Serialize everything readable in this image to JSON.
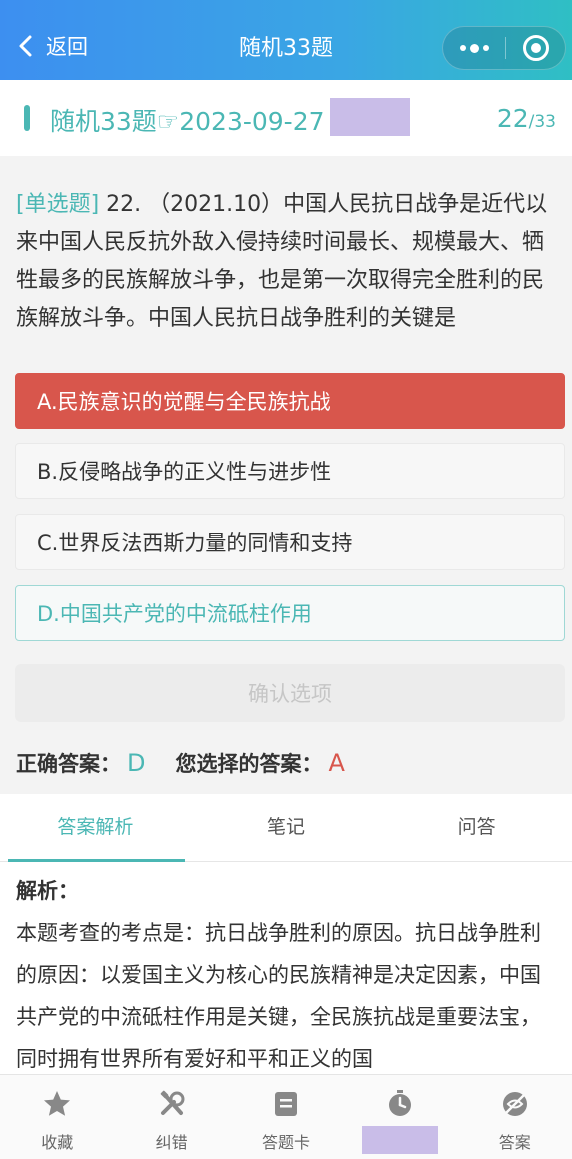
{
  "topbar": {
    "back_label": "返回",
    "title": "随机33题"
  },
  "quiz_header": {
    "title": "随机33题☞2023-09-27",
    "current": "22",
    "total": "/33"
  },
  "question": {
    "type_label": "[单选题]",
    "text": " 22. （2021.10）中国人民抗日战争是近代以来中国人民反抗外敌入侵持续时间最长、规模最大、牺牲最多的民族解放斗争，也是第一次取得完全胜利的民族解放斗争。中国人民抗日战争胜利的关键是"
  },
  "options": [
    {
      "label": "A.民族意识的觉醒与全民族抗战",
      "state": "wrong"
    },
    {
      "label": "B.反侵略战争的正义性与进步性",
      "state": "normal"
    },
    {
      "label": "C.世界反法西斯力量的同情和支持",
      "state": "normal"
    },
    {
      "label": "D.中国共产党的中流砥柱作用",
      "state": "correct"
    }
  ],
  "confirm_label": "确认选项",
  "result": {
    "correct_label": "正确答案：",
    "correct_value": "D",
    "chosen_label": "您选择的答案：",
    "chosen_value": "A"
  },
  "tabs": [
    {
      "label": "答案解析",
      "active": true
    },
    {
      "label": "笔记",
      "active": false
    },
    {
      "label": "问答",
      "active": false
    }
  ],
  "analysis": {
    "title": "解析：",
    "body": "本题考查的考点是：抗日战争胜利的原因。抗日战争胜利的原因：以爱国主义为核心的民族精神是决定因素，中国共产党的中流砥柱作用是关键，全民族抗战是重要法宝，同时拥有世界所有爱好和平和正义的国"
  },
  "bottom_nav": [
    {
      "label": "收藏",
      "icon": "star-icon"
    },
    {
      "label": "纠错",
      "icon": "tools-icon"
    },
    {
      "label": "答题卡",
      "icon": "answer-card-icon"
    },
    {
      "label": "",
      "icon": "stopwatch-icon"
    },
    {
      "label": "答案",
      "icon": "hide-answer-icon"
    }
  ],
  "colors": {
    "accent": "#4bb7b4",
    "wrong": "#d8564c",
    "redaction": "#c9bde8"
  }
}
